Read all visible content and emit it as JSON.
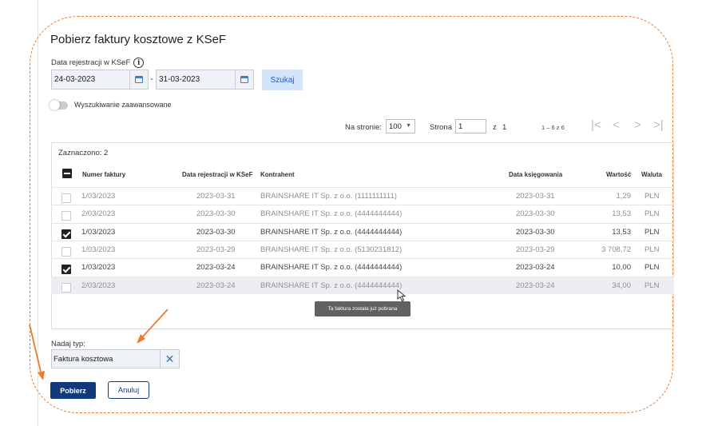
{
  "dialog": {
    "title": "Pobierz faktury kosztowe z KSeF",
    "date_label": "Data rejestracji w KSeF",
    "date_from": "24-03-2023",
    "date_separator": "-",
    "date_to": "31-03-2023",
    "search_label": "Szukaj",
    "advanced_search_label": "Wyszukiwanie zaawansowane",
    "advanced_search_enabled": false
  },
  "pager": {
    "per_page_label": "Na stronie:",
    "per_page_value": "100",
    "page_label": "Strona",
    "page_value": "1",
    "of_label": "z",
    "of_value": "1",
    "range": "1 – 6 z 6"
  },
  "table": {
    "selected_count": "Zaznaczono: 2",
    "headers": {
      "number": "Numer faktury",
      "reg_date": "Data rejestracji w KSeF",
      "contractor": "Kontrahent",
      "booking_date": "Data księgowania",
      "value": "Wartość",
      "currency": "Waluta"
    },
    "rows": [
      {
        "number": "1/03/2023",
        "reg_date": "2023-03-31",
        "contractor": "BRAINSHARE IT Sp. z o.o. (1111111111)",
        "booking_date": "2023-03-31",
        "value": "1,29",
        "currency": "PLN",
        "checked": false,
        "muted": true
      },
      {
        "number": "2/03/2023",
        "reg_date": "2023-03-30",
        "contractor": "BRAINSHARE IT Sp. z o.o. (4444444444)",
        "booking_date": "2023-03-30",
        "value": "13,53",
        "currency": "PLN",
        "checked": false,
        "muted": true
      },
      {
        "number": "1/03/2023",
        "reg_date": "2023-03-30",
        "contractor": "BRAINSHARE IT Sp. z o.o. (4444444444)",
        "booking_date": "2023-03-30",
        "value": "13,53",
        "currency": "PLN",
        "checked": true,
        "muted": false
      },
      {
        "number": "1/03/2023",
        "reg_date": "2023-03-29",
        "contractor": "BRAINSHARE IT Sp. z o.o. (5130231812)",
        "booking_date": "2023-03-29",
        "value": "3 708,72",
        "currency": "PLN",
        "checked": false,
        "muted": true
      },
      {
        "number": "1/03/2023",
        "reg_date": "2023-03-24",
        "contractor": "BRAINSHARE IT Sp. z o.o. (4444444444)",
        "booking_date": "2023-03-24",
        "value": "10,00",
        "currency": "PLN",
        "checked": true,
        "muted": false
      },
      {
        "number": "2/03/2023",
        "reg_date": "2023-03-24",
        "contractor": "BRAINSHARE IT Sp. z o.o. (4444444444)",
        "booking_date": "2023-03-24",
        "value": "34,00",
        "currency": "PLN",
        "checked": false,
        "muted": true
      }
    ],
    "tooltip": "Ta faktura została już pobrana"
  },
  "type_field": {
    "label": "Nadaj typ:",
    "value": "Faktura kosztowa"
  },
  "actions": {
    "primary": "Pobierz",
    "secondary": "Anuluj"
  },
  "colors": {
    "primary": "#123a7a",
    "accent": "#1e5fbf",
    "annotation": "#ee7a2a"
  }
}
